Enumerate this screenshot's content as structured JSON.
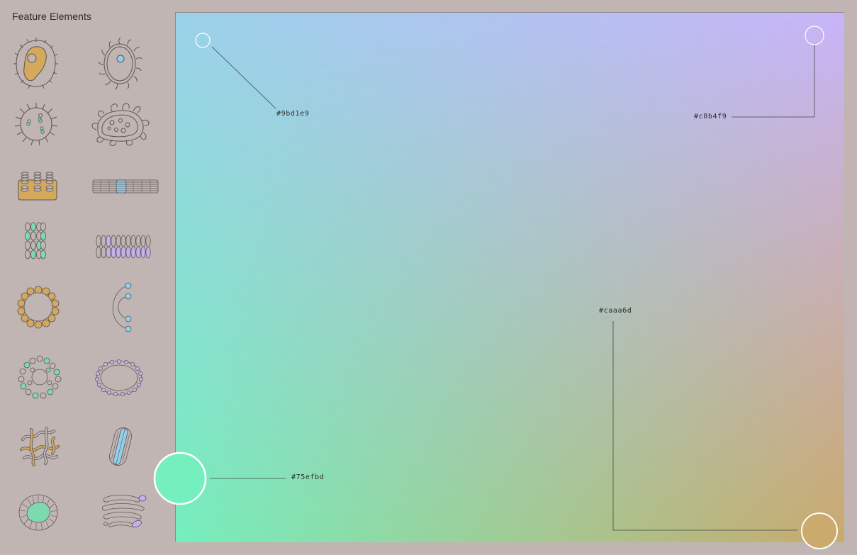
{
  "sidebar": {
    "title": "Feature Elements",
    "items": [
      {
        "name": "cell-amoeboid-icon"
      },
      {
        "name": "cell-ciliated-icon"
      },
      {
        "name": "cell-spiky-icon"
      },
      {
        "name": "cell-ruffled-icon"
      },
      {
        "name": "membrane-block-icon"
      },
      {
        "name": "membrane-stack-icon"
      },
      {
        "name": "vesicle-grid-icon"
      },
      {
        "name": "lipid-row-icon"
      },
      {
        "name": "ring-beads-icon"
      },
      {
        "name": "arc-nodes-icon"
      },
      {
        "name": "cluster-ring-icon"
      },
      {
        "name": "oval-beads-icon"
      },
      {
        "name": "tangle-icon"
      },
      {
        "name": "tube-capsule-icon"
      },
      {
        "name": "frilled-disc-icon"
      },
      {
        "name": "golgi-stack-icon"
      }
    ]
  },
  "canvas": {
    "gradient_stops": [
      {
        "name": "top-left",
        "color": "#9bd1e9"
      },
      {
        "name": "top-right",
        "color": "#c8b4f9"
      },
      {
        "name": "bottom-left",
        "color": "#75efbd"
      },
      {
        "name": "bottom-right",
        "color": "#caaa6d"
      }
    ],
    "labels": {
      "top_left": "#9bd1e9",
      "top_right": "#c8b4f9",
      "bottom_left": "#75efbd",
      "bottom_right": "#caaa6d"
    }
  },
  "colors": {
    "background": "#c0b5b3",
    "outline": "#5c5456",
    "gold": "#d4a95b",
    "blue": "#93cfe8",
    "green": "#7dd9b0",
    "lavender": "#c4b0ea"
  }
}
